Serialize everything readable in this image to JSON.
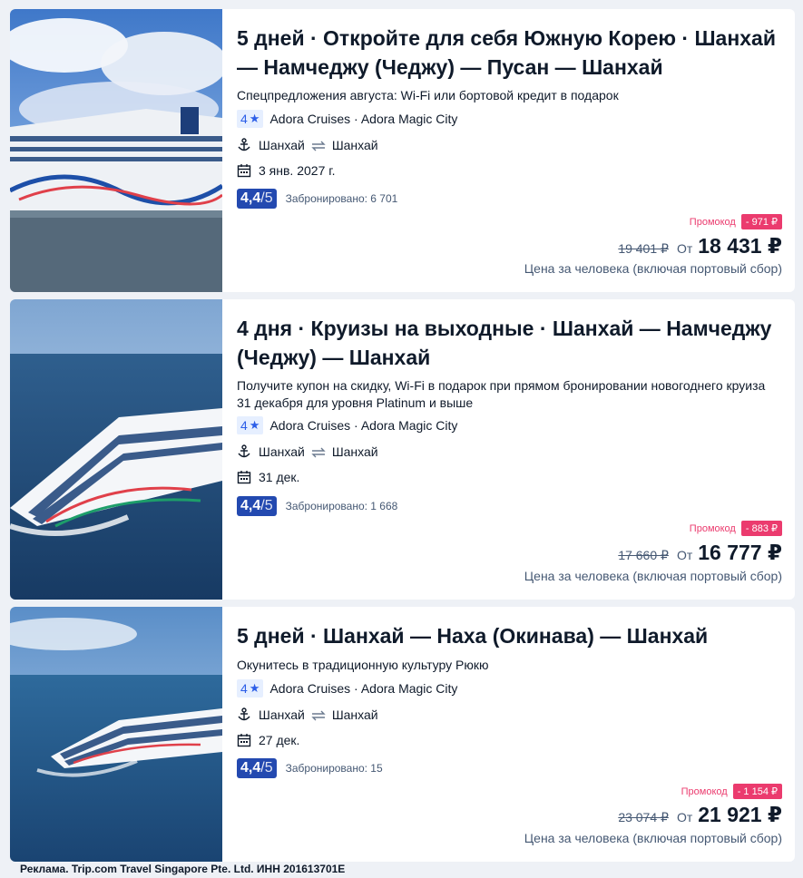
{
  "cards": [
    {
      "title": "5 дней · Откройте для себя Южную Корею · Шанхай — Намчеджу (Чеджу) — Пусан — Шанхай",
      "promo": "Спецпредложения августа: Wi-Fi или бортовой кредит в подарок",
      "stars": "4",
      "line": "Adora Cruises · Adora Magic City",
      "from_port": "Шанхай",
      "to_port": "Шанхай",
      "date": "3 янв. 2027 г.",
      "rating": "4,4",
      "rating_den": "/5",
      "booked": "Забронировано: 6 701",
      "promo_label": "Промокод",
      "discount": "- 971 ₽",
      "old_price": "19 401 ₽",
      "from_label": "От",
      "price": "18 431 ₽",
      "note": "Цена за человека (включая портовый сбор)"
    },
    {
      "title": "4 дня · Круизы на выходные · Шанхай — Намчеджу (Чеджу) — Шанхай",
      "promo": "Получите купон на скидку, Wi-Fi в подарок при прямом бронировании новогоднего круиза 31 декабря для уровня Platinum и выше",
      "stars": "4",
      "line": "Adora Cruises · Adora Magic City",
      "from_port": "Шанхай",
      "to_port": "Шанхай",
      "date": "31 дек.",
      "rating": "4,4",
      "rating_den": "/5",
      "booked": "Забронировано: 1 668",
      "promo_label": "Промокод",
      "discount": "- 883 ₽",
      "old_price": "17 660 ₽",
      "from_label": "От",
      "price": "16 777 ₽",
      "note": "Цена за человека (включая портовый сбор)"
    },
    {
      "title": "5 дней · Шанхай — Наха (Окинава) — Шанхай",
      "promo": "Окунитесь в традиционную культуру Рюкю",
      "stars": "4",
      "line": "Adora Cruises · Adora Magic City",
      "from_port": "Шанхай",
      "to_port": "Шанхай",
      "date": "27 дек.",
      "rating": "4,4",
      "rating_den": "/5",
      "booked": "Забронировано: 15",
      "promo_label": "Промокод",
      "discount": "- 1 154 ₽",
      "old_price": "23 074 ₽",
      "from_label": "От",
      "price": "21 921 ₽",
      "note": "Цена за человека (включая портовый сбор)"
    }
  ],
  "footer": {
    "ad": "Реклама. Trip.com Travel Singapore Pte. Ltd. ИНН 201613701E"
  },
  "colors": {
    "accent_blue": "#2349b0",
    "promo_pink": "#eb3b6e",
    "star_blue": "#2c5ee8"
  }
}
